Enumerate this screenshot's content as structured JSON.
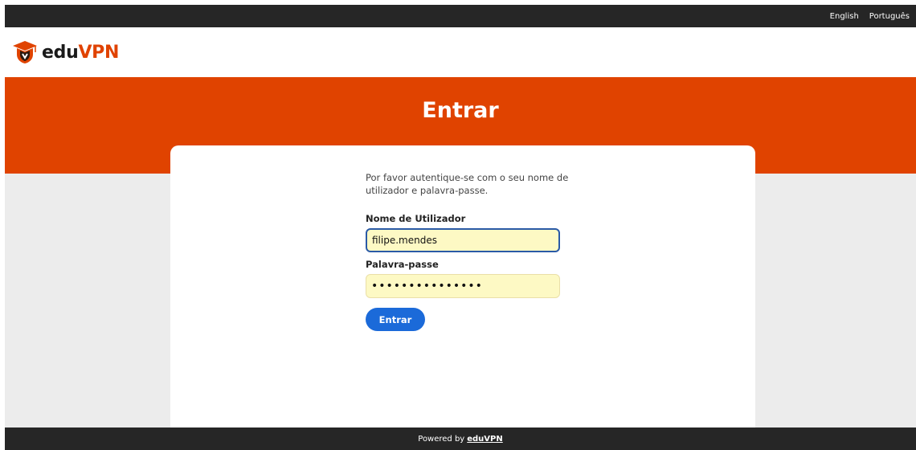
{
  "languages": [
    "English",
    "Português"
  ],
  "brand": {
    "name_prefix": "edu",
    "name_suffix": "VPN",
    "color": "#e04300"
  },
  "page": {
    "title": "Entrar"
  },
  "form": {
    "intro": "Por favor autentique-se com o seu nome de utilizador e palavra-passe.",
    "username_label": "Nome de Utilizador",
    "username_value": "filipe.mendes",
    "password_label": "Palavra-passe",
    "password_value": "•••••••••••••••",
    "submit_label": "Entrar"
  },
  "footer": {
    "prefix": "Powered by",
    "link": "eduVPN"
  },
  "colors": {
    "topbar": "#262626",
    "banner": "#e04300",
    "button": "#1b6ad9",
    "input_bg": "#fdf9c4"
  }
}
